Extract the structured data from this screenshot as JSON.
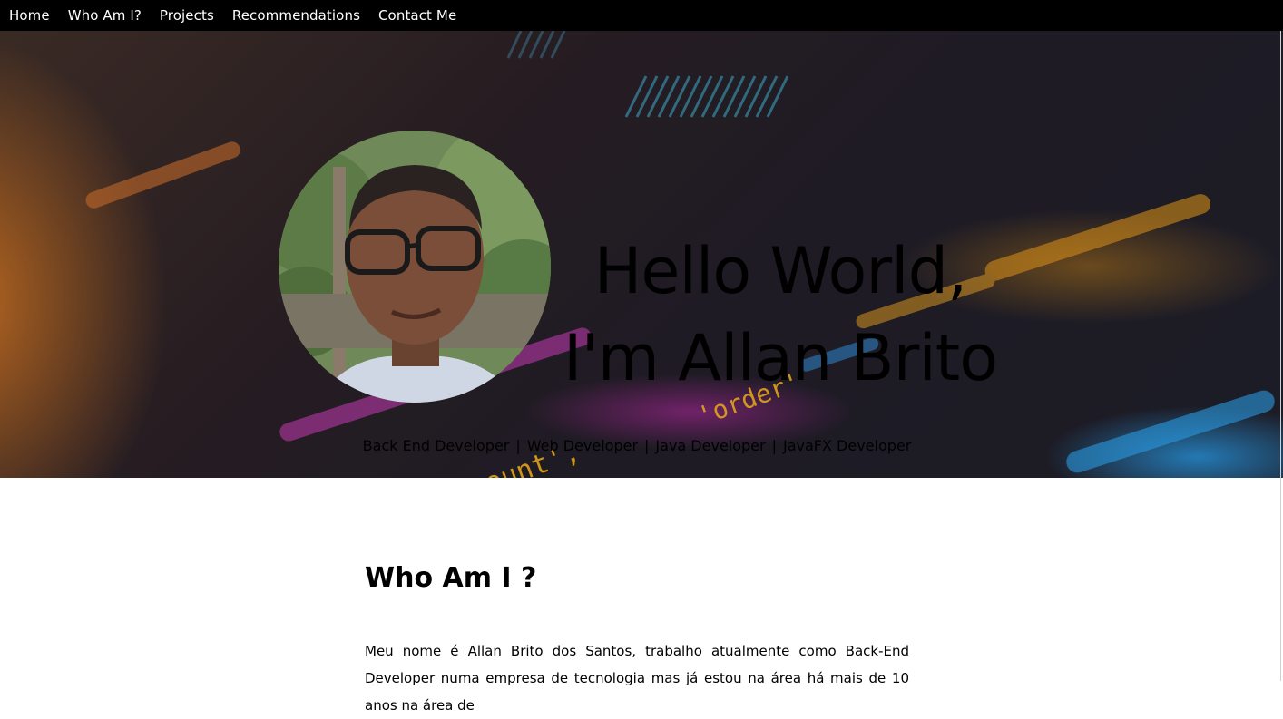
{
  "nav": {
    "items": [
      {
        "label": "Home"
      },
      {
        "label": "Who Am I?"
      },
      {
        "label": "Projects"
      },
      {
        "label": "Recommendations"
      },
      {
        "label": "Contact Me"
      }
    ]
  },
  "hero": {
    "greeting_line1": "Hello World,",
    "greeting_line2": "I'm Allan Brito",
    "roles": [
      "Back End Developer",
      "Web Developer",
      "Java Developer",
      "JavaFX Developer"
    ],
    "separator": "|",
    "code_text_1": "count',",
    "code_text_2": "'order'"
  },
  "who": {
    "title": "Who Am I ?",
    "paragraph": "Meu nome é Allan Brito dos Santos, trabalho atualmente como Back-End Developer numa empresa de tecnologia mas já estou na área há mais de 10 anos na área de"
  }
}
